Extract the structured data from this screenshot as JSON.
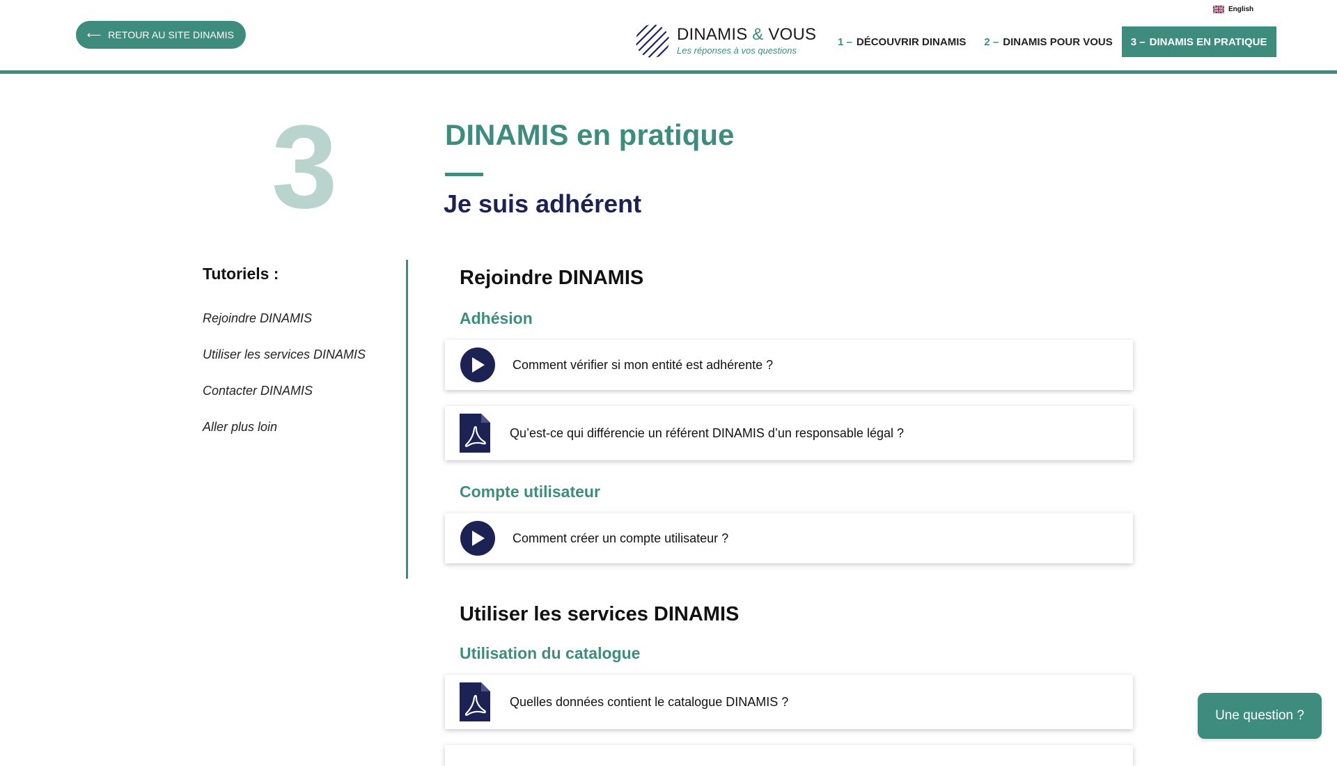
{
  "header": {
    "back_label": "RETOUR AU SITE DINAMIS",
    "language": "English",
    "logo_brand_a": "DINAMIS",
    "logo_brand_amp": "&",
    "logo_brand_b": "VOUS",
    "logo_tagline": "Les réponses à vos questions",
    "nav": [
      {
        "num": "1 –",
        "label": "DÉCOUVRIR DINAMIS"
      },
      {
        "num": "2 –",
        "label": "DINAMIS POUR VOUS"
      },
      {
        "num": "3 –",
        "label": "DINAMIS EN PRATIQUE"
      }
    ]
  },
  "hero": {
    "number": "3",
    "title": "DINAMIS en pratique",
    "subtitle": "Je suis adhérent"
  },
  "sidebar": {
    "heading": "Tutoriels :",
    "links": [
      "Rejoindre DINAMIS",
      "Utiliser les services DINAMIS",
      "Contacter DINAMIS",
      "Aller plus loin"
    ]
  },
  "content": {
    "section1": {
      "title": "Rejoindre DINAMIS",
      "group1": {
        "title": "Adhésion",
        "items": [
          {
            "type": "video",
            "text": "Comment vérifier si mon entité est adhérente ?"
          },
          {
            "type": "pdf",
            "text": "Qu’est-ce qui différencie un référent DINAMIS d’un responsable légal ?"
          }
        ]
      },
      "group2": {
        "title": "Compte utilisateur",
        "items": [
          {
            "type": "video",
            "text": "Comment créer un compte utilisateur ?"
          }
        ]
      }
    },
    "section2": {
      "title": "Utiliser les services DINAMIS",
      "group1": {
        "title": "Utilisation du catalogue",
        "items": [
          {
            "type": "pdf",
            "text": "Quelles données contient le catalogue DINAMIS ?"
          }
        ]
      }
    }
  },
  "question_button": "Une question ?",
  "colors": {
    "teal": "#3e8c7e",
    "navy": "#1c2354",
    "light_teal": "#b9d3cd"
  }
}
